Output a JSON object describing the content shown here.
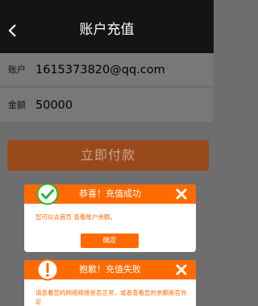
{
  "header": {
    "title": "账户充值",
    "back_icon": "chevron-left-icon"
  },
  "form": {
    "account_label": "账户",
    "account_value": "1615373820@qq.com",
    "amount_label": "金额",
    "amount_value": "50000"
  },
  "pay_button_label": "立即付款",
  "success_dialog": {
    "icon": "checkmark-circle-icon",
    "title": "恭喜！充值成功",
    "message": "您可以去首页 查看账户余额。",
    "confirm_label": "确定",
    "close_icon": "close-icon"
  },
  "fail_dialog": {
    "icon": "exclamation-circle-icon",
    "title": "抱歉！充值失败",
    "message": "请查看您的网络链接是否正常，或者查看您的余额是否充足",
    "close_icon": "close-icon"
  },
  "colors": {
    "accent": "#ff6a00",
    "topbar": "#141414",
    "overlay_background": "#6e6e6e",
    "success_green": "#2db52d",
    "pay_button_dimmed": "#994a1d"
  }
}
